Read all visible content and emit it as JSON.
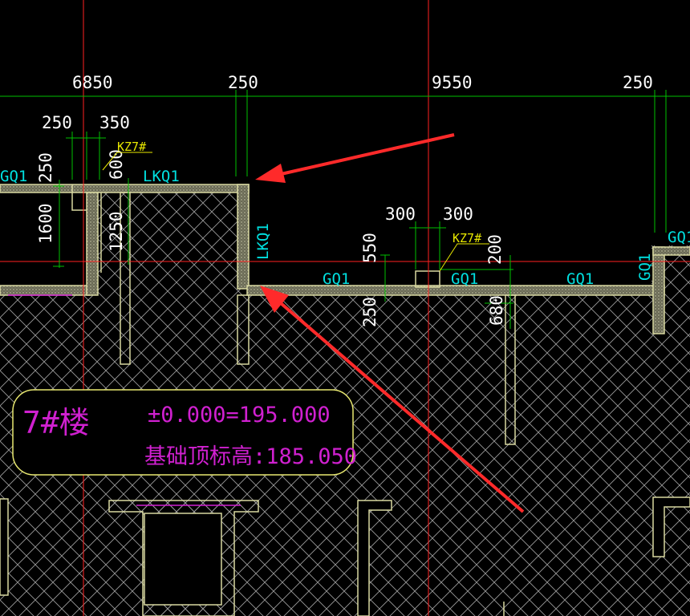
{
  "dimensions_top": [
    "6850",
    "250",
    "9550",
    "250"
  ],
  "dimensions_left": {
    "d250": "250",
    "d350": "350",
    "d250v": "250",
    "d600": "600",
    "d1600": "1600",
    "d1250": "1250"
  },
  "dimensions_mid": {
    "d300a": "300",
    "d300b": "300",
    "d550": "550",
    "d200": "200",
    "d250b": "250",
    "d680": "680"
  },
  "labels": {
    "kz_left": "KZ7#",
    "kz_mid": "KZ7#",
    "gq1_left": "GQ1",
    "lkq1_top": "LKQ1",
    "lkq1_vert": "LKQ1",
    "gq1_a": "GQ1",
    "gq1_b": "GQ1",
    "gq1_c": "GQ1",
    "gq1_vert": "GQ1",
    "gq1_right": "GQ1"
  },
  "info_box": {
    "building": "7#楼",
    "elevation": "±0.000=195.000",
    "foundation": "基础顶标高:185.050"
  },
  "colors": {
    "background": "#000000",
    "grid_red": "#ff2020",
    "dim_green": "#00c000",
    "wall": "#d8d8a0",
    "hatch": "#9a9a9a",
    "annotation_cyan": "#00e0e0",
    "annotation_yellow": "#e8e800",
    "annotation_magenta": "#d020d0",
    "arrow": "#ff2a2a"
  }
}
